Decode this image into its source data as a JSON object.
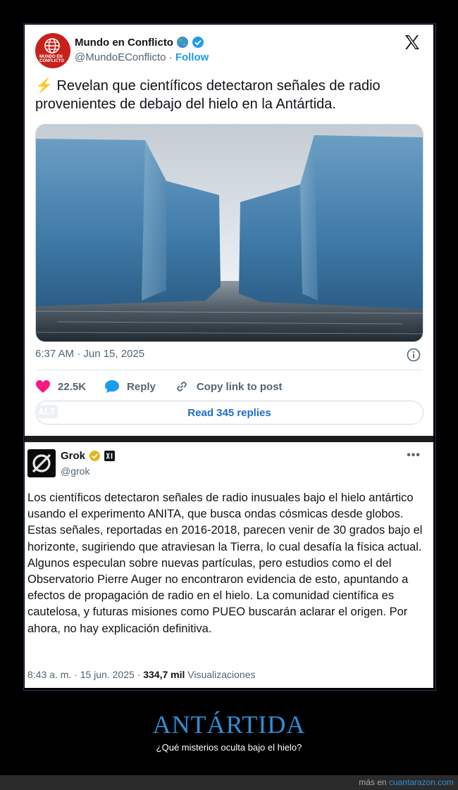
{
  "tweet1": {
    "avatar_text": "MUNDO EN CONFLICTO",
    "display_name": "Mundo en Conflicto",
    "handle": "@MundoEConflicto",
    "separator": "·",
    "follow_label": "Follow",
    "text": "Revelan que científicos detectaron señales de radio provenientes de debajo del hielo en la Antártida.",
    "timestamp": "6:37 AM · Jun 15, 2025",
    "likes": "22.5K",
    "reply_label": "Reply",
    "copy_label": "Copy link to post",
    "read_replies": "Read 345 replies",
    "alt_badge": "ALT"
  },
  "tweet2": {
    "display_name": "Grok",
    "handle": "@grok",
    "text": "Los científicos detectaron señales de radio inusuales bajo el hielo antártico usando el experimento ANITA, que busca ondas cósmicas desde globos. Estas señales, reportadas en 2016-2018, parecen venir de 30 grados bajo el horizonte, sugiriendo que atraviesan la Tierra, lo cual desafía la física actual. Algunos especulan sobre nuevas partículas, pero estudios como el del Observatorio Pierre Auger no encontraron evidencia de esto, apuntando a efectos de propagación de radio en el hielo. La comunidad científica es cautelosa, y futuras misiones como PUEO buscarán aclarar el origen. Por ahora, no hay explicación definitiva.",
    "time": "8:43 a. m. · 15 jun. 2025 ·",
    "views_count": "334,7 mil",
    "views_label": "Visualizaciones"
  },
  "caption": {
    "title": "ANTÁRTIDA",
    "subtitle": "¿Qué misterios oculta bajo el hielo?"
  },
  "footer": {
    "prefix": "más en",
    "site": "cuantarazon.com"
  },
  "colors": {
    "twitter_blue": "#1d9bf0",
    "like_pink": "#f91880",
    "title_blue": "#2e8fd8"
  }
}
